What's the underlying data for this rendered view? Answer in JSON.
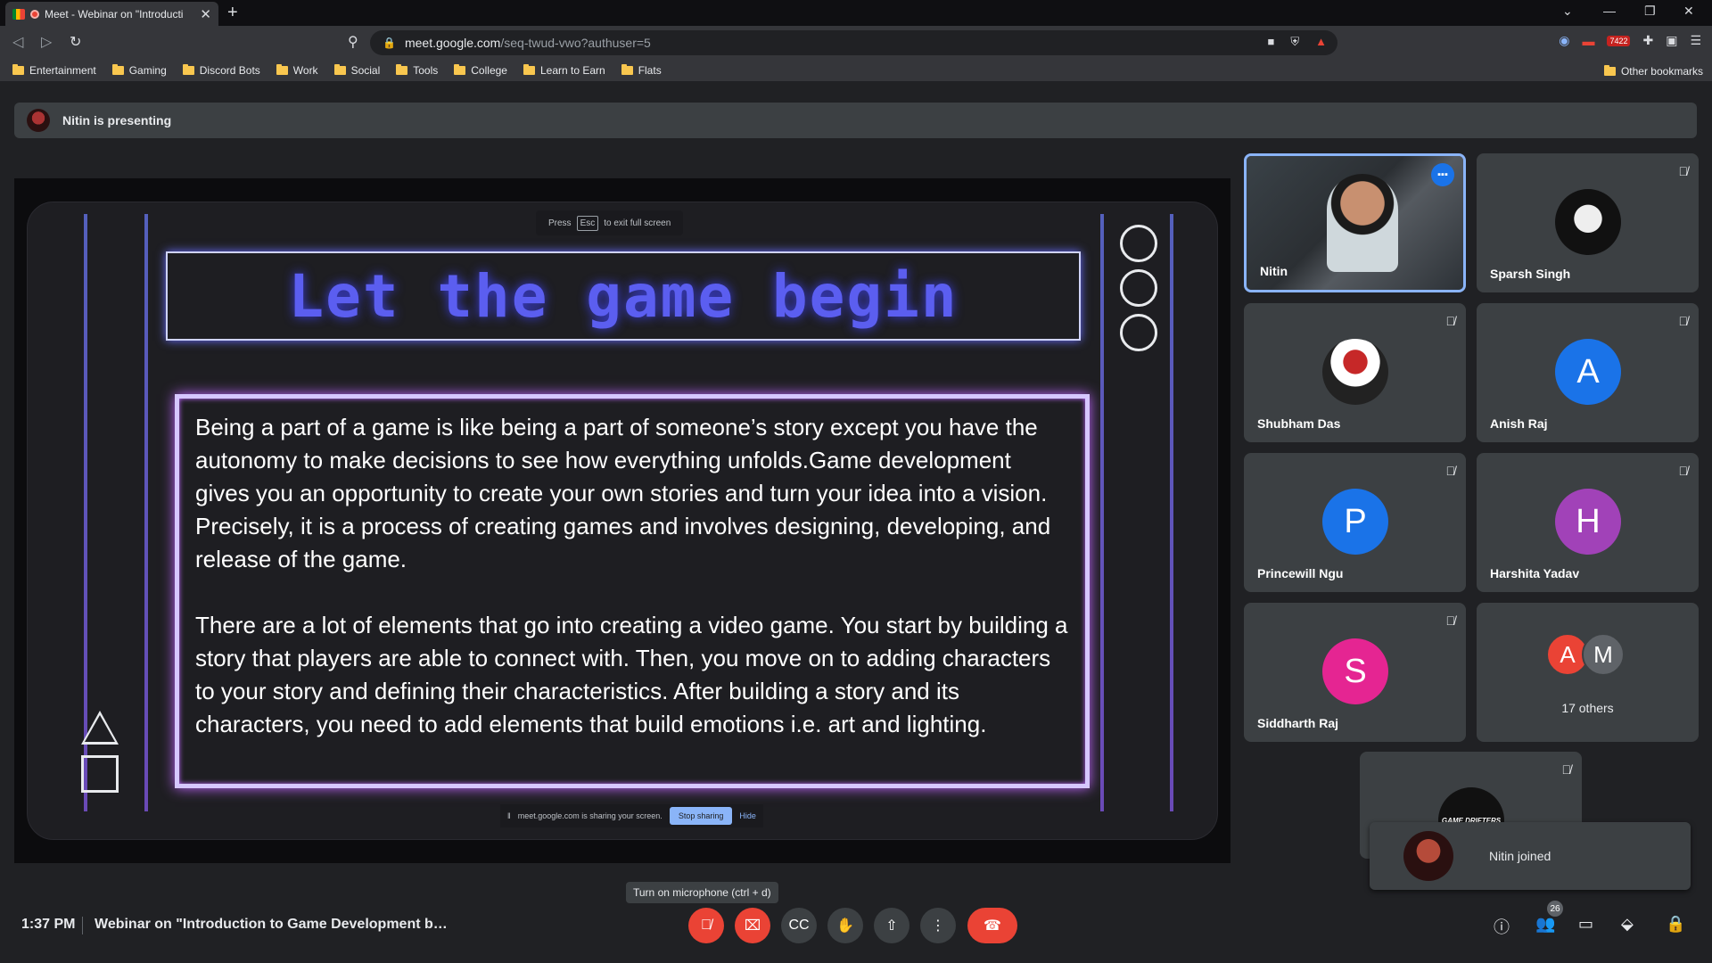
{
  "browser": {
    "tab_title": "Meet - Webinar on \"Introducti",
    "url_host": "meet.google.com",
    "url_path": "/seq-twud-vwo?authuser=5",
    "extension_badge": "7422",
    "bookmarks": [
      "Entertainment",
      "Gaming",
      "Discord Bots",
      "Work",
      "Social",
      "Tools",
      "College",
      "Learn to Earn",
      "Flats"
    ],
    "other_bookmarks": "Other bookmarks"
  },
  "presenting": {
    "label": "Nitin is presenting"
  },
  "slide": {
    "fullscreen_hint_pre": "Press",
    "fullscreen_hint_key": "Esc",
    "fullscreen_hint_post": "to exit full screen",
    "title": "Let the game begin",
    "paragraph_1": "Being a part of a game is like being a part of someone’s story except you have the autonomy to make decisions to see how everything unfolds.Game development gives you an opportunity to create your own stories and turn your idea into a vision. Precisely, it is a process of creating games and involves designing, developing, and release of the game.",
    "paragraph_2": "There are a lot of elements that go into creating a video game. You start by building a story that players are able to connect with. Then, you move on to adding characters to your story and defining their characteristics. After building a story and its characters, you need to add elements that build emotions i.e. art and lighting.",
    "share_notice": "meet.google.com is sharing your screen.",
    "stop_sharing": "Stop sharing",
    "hide": "Hide"
  },
  "participants": [
    {
      "name": "Nitin",
      "initial": "",
      "color": ""
    },
    {
      "name": "Sparsh Singh",
      "initial": "",
      "color": ""
    },
    {
      "name": "Shubham Das",
      "initial": "",
      "color": ""
    },
    {
      "name": "Anish Raj",
      "initial": "A",
      "color": "#1a73e8"
    },
    {
      "name": "Princewill Ngu",
      "initial": "P",
      "color": "#1a73e8"
    },
    {
      "name": "Harshita Yadav",
      "initial": "H",
      "color": "#a142b8"
    },
    {
      "name": "Siddharth Raj",
      "initial": "S",
      "color": "#e52592"
    }
  ],
  "others": {
    "initials": [
      "A",
      "M"
    ],
    "colors": [
      "#ea4335",
      "#5f6368"
    ],
    "label": "17 others"
  },
  "gd_logo_text": "GAME DRIFTERS",
  "toast": {
    "text": "Nitin joined"
  },
  "tooltip": "Turn on microphone (ctrl + d)",
  "bottom": {
    "time": "1:37 PM",
    "meeting_title": "Webinar on \"Introduction to Game Development by ...",
    "people_count": "26"
  }
}
